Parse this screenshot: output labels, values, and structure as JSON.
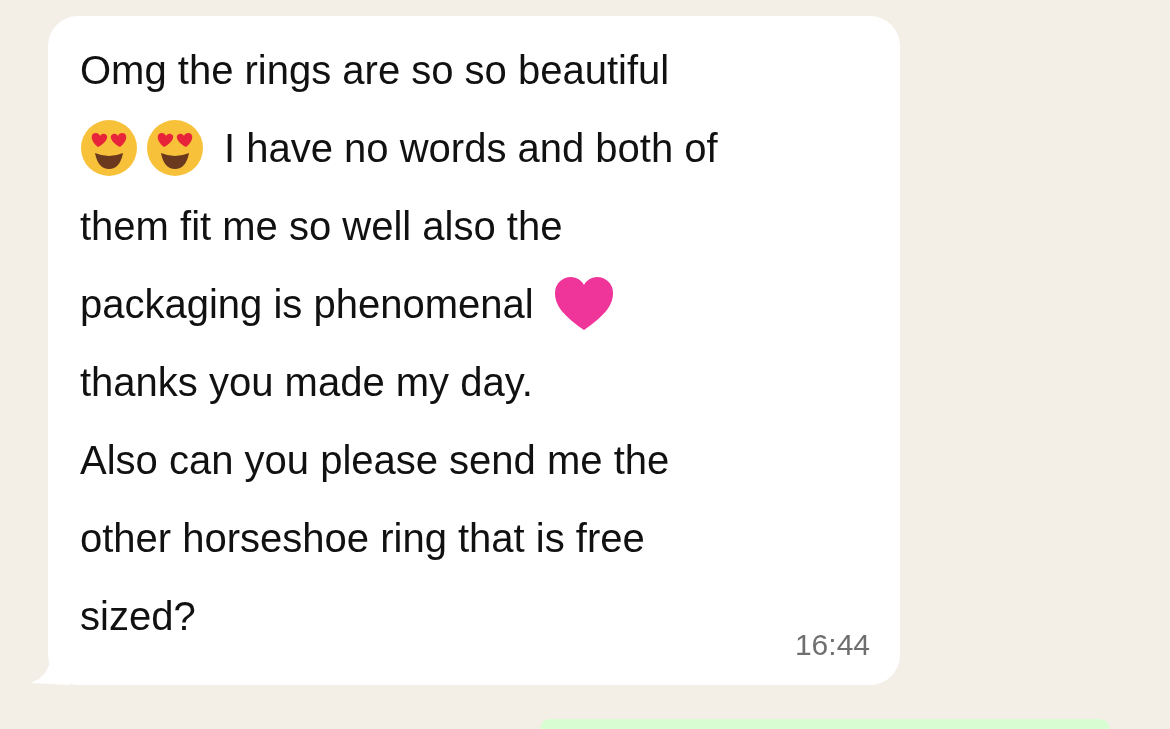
{
  "message": {
    "lines": [
      {
        "parts": [
          {
            "kind": "text",
            "text": "Omg the rings are so so beautiful"
          }
        ]
      },
      {
        "parts": [
          {
            "kind": "face"
          },
          {
            "kind": "face"
          },
          {
            "kind": "text",
            "text": "I have no words and both of"
          }
        ]
      },
      {
        "parts": [
          {
            "kind": "text",
            "text": "them fit me so well also the"
          }
        ]
      },
      {
        "parts": [
          {
            "kind": "text",
            "text": "packaging is phenomenal"
          },
          {
            "kind": "heart"
          }
        ]
      },
      {
        "parts": [
          {
            "kind": "text",
            "text": "thanks you made my day."
          }
        ]
      },
      {
        "parts": [
          {
            "kind": "text",
            "text": "Also can you please send me the"
          }
        ]
      },
      {
        "parts": [
          {
            "kind": "text",
            "text": "other horseshoe ring that is free"
          }
        ]
      },
      {
        "parts": [
          {
            "kind": "text",
            "text": "sized?"
          }
        ]
      }
    ],
    "time": "16:44"
  }
}
